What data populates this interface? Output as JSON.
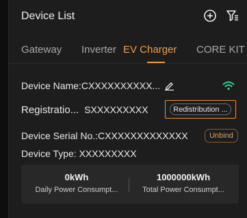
{
  "header": {
    "title": "Device List",
    "add_icon": "plus-circle-icon",
    "filter_icon": "filter-icon"
  },
  "tabs": [
    {
      "label": "Gateway",
      "active": false
    },
    {
      "label": "Inverter",
      "active": false
    },
    {
      "label": "EV Charger",
      "active": true
    },
    {
      "label": "CORE KIT",
      "active": false
    }
  ],
  "device": {
    "name_label": "Device Name:",
    "name_value": "CXXXXXXXXXX...",
    "registration_label": "Registratio...",
    "registration_value": "SXXXXXXXXX",
    "redistribution_button": "Redistribution ...",
    "serial_label": "Device Serial No.:",
    "serial_value": "CXXXXXXXXXXXXX",
    "unbind_button": "Unbind",
    "type_label": "Device Type:",
    "type_value": "XXXXXXXXX"
  },
  "stats": {
    "daily_value": "0kWh",
    "daily_label": "Daily Power Consumpt...",
    "total_value": "1000000kWh",
    "total_label": "Total Power Consumpt..."
  },
  "colors": {
    "accent": "#f29c3c",
    "wifi": "#2fd38f",
    "background": "#1d1d1d"
  }
}
